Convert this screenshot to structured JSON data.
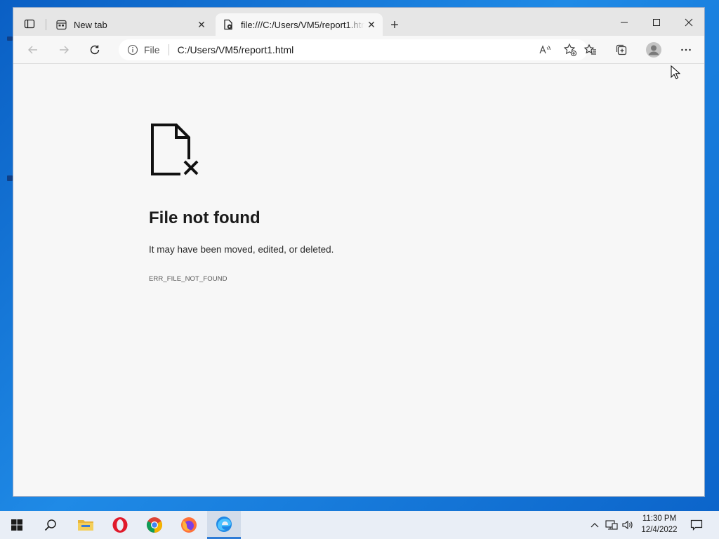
{
  "browser": {
    "tabs": [
      {
        "title": "New tab",
        "active": false,
        "favicon": "new-tab-page-icon"
      },
      {
        "title": "file:///C:/Users/VM5/report1.html",
        "active": true,
        "favicon": "file-error-icon"
      }
    ],
    "address_bar": {
      "scheme_label": "File",
      "url": "C:/Users/VM5/report1.html"
    }
  },
  "page": {
    "title": "File not found",
    "description": "It may have been moved, edited, or deleted.",
    "error_code": "ERR_FILE_NOT_FOUND"
  },
  "taskbar": {
    "apps": [
      "start-icon",
      "search-icon",
      "file-explorer-icon",
      "opera-icon",
      "chrome-icon",
      "firefox-icon",
      "edge-icon"
    ],
    "clock": {
      "time": "11:30 PM",
      "date": "12/4/2022"
    }
  },
  "colors": {
    "accent": "#2d7bd6",
    "taskbar_bg": "#e9eef6",
    "page_bg": "#f7f7f7"
  }
}
